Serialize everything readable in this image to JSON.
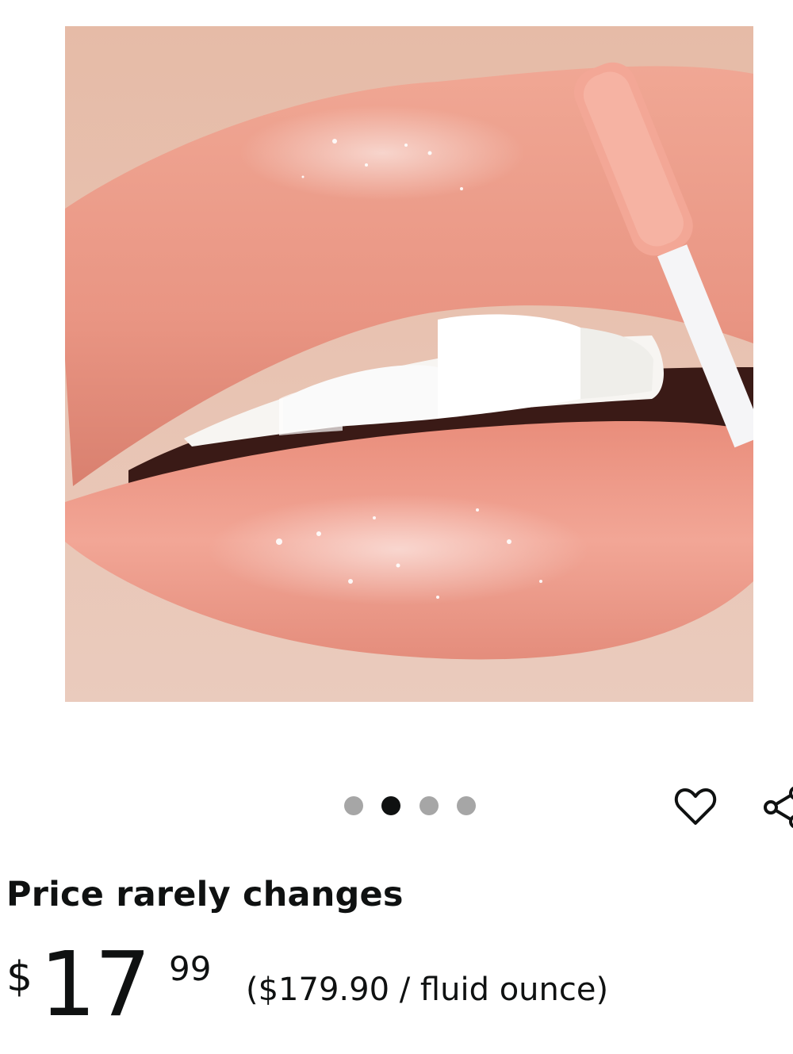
{
  "product": {
    "image_description_icon": "lip-gloss-photo"
  },
  "carousel": {
    "dot_count": 4,
    "active_index": 1
  },
  "actions": {
    "wishlist_icon": "heart-icon",
    "share_icon": "share-icon"
  },
  "price": {
    "heading": "Price rarely changes",
    "symbol": "$",
    "whole": "17",
    "fraction": "99",
    "unit_price": "($179.90 / fluid ounce)"
  },
  "colors": {
    "text": "#0f1111",
    "dot_inactive": "#a6a6a6",
    "dot_active": "#0f1111",
    "lip": "#e79a86"
  }
}
